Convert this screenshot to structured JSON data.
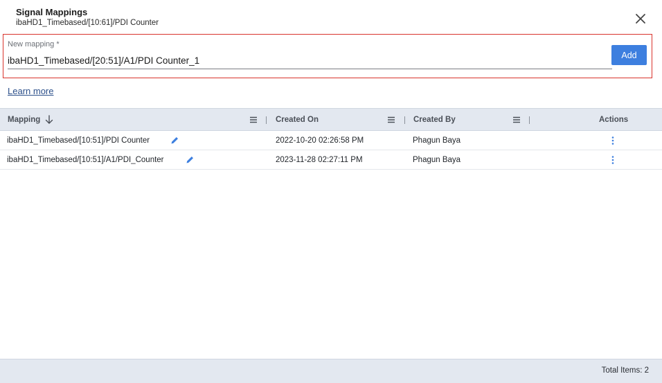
{
  "dialog": {
    "title": "Signal Mappings",
    "subtitle": "ibaHD1_Timebased/[10:61]/PDI Counter",
    "close_icon": "close-icon"
  },
  "new_mapping": {
    "label": "New mapping *",
    "value": "ibaHD1_Timebased/[20:51]/A1/PDI Counter_1",
    "add_label": "Add"
  },
  "learn_more": "Learn more",
  "grid": {
    "columns": {
      "mapping": "Mapping",
      "created_on": "Created On",
      "created_by": "Created By",
      "actions": "Actions"
    },
    "rows": [
      {
        "mapping": "ibaHD1_Timebased/[10:51]/PDI Counter",
        "created_on": "2022-10-20 02:26:58 PM",
        "created_by": "Phagun Baya"
      },
      {
        "mapping": "ibaHD1_Timebased/[10:51]/A1/PDI_Counter",
        "created_on": "2023-11-28 02:27:11 PM",
        "created_by": "Phagun Baya"
      }
    ]
  },
  "footer": {
    "total_items": "Total Items: 2"
  },
  "colors": {
    "accent": "#3d7fdf",
    "highlight_border": "#d9322b",
    "header_bg": "#e3e8f0"
  }
}
